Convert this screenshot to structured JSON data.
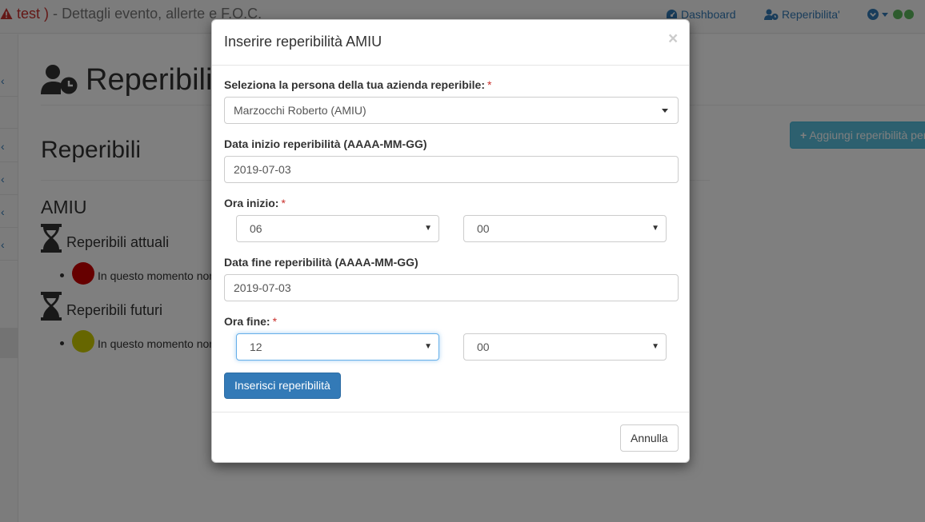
{
  "navbar": {
    "event_name": "test )",
    "separator": "-",
    "subtitle": "Dettagli evento, allerte e F.O.C.",
    "links": [
      {
        "label": "Dashboard",
        "icon": "dashboard-icon"
      },
      {
        "label": "Reperibilita'",
        "icon": "user-clock-icon"
      }
    ],
    "status_colors": [
      "#5cb85c",
      "#5cb85c"
    ]
  },
  "page": {
    "title": "Reperibilità",
    "section_title": "Reperibili",
    "add_button": "Aggiungi reperibilità per AMIU",
    "company": "AMIU",
    "current_heading": "Reperibili attuali",
    "current_text": "In questo momento non ci sono reperibili",
    "current_color": "#cc0000",
    "future_heading": "Reperibili futuri",
    "future_text": "In questo momento non ci sono reperibili",
    "future_color": "#cccc00"
  },
  "modal": {
    "title": "Inserire reperibilità AMIU",
    "close": "×",
    "person_label": "Seleziona la persona della tua azienda reperibile:",
    "person_value": "Marzocchi Roberto (AMIU)",
    "start_date_label": "Data inizio reperibilità (AAAA-MM-GG)",
    "start_date_value": "2019-07-03",
    "start_time_label": "Ora inizio:",
    "start_hour": "06",
    "start_minute": "00",
    "end_date_label": "Data fine reperibilità (AAAA-MM-GG)",
    "end_date_value": "2019-07-03",
    "end_time_label": "Ora fine:",
    "end_hour": "12",
    "end_minute": "00",
    "required_mark": "*",
    "submit_label": "Inserisci reperibilità",
    "cancel_label": "Annulla"
  }
}
